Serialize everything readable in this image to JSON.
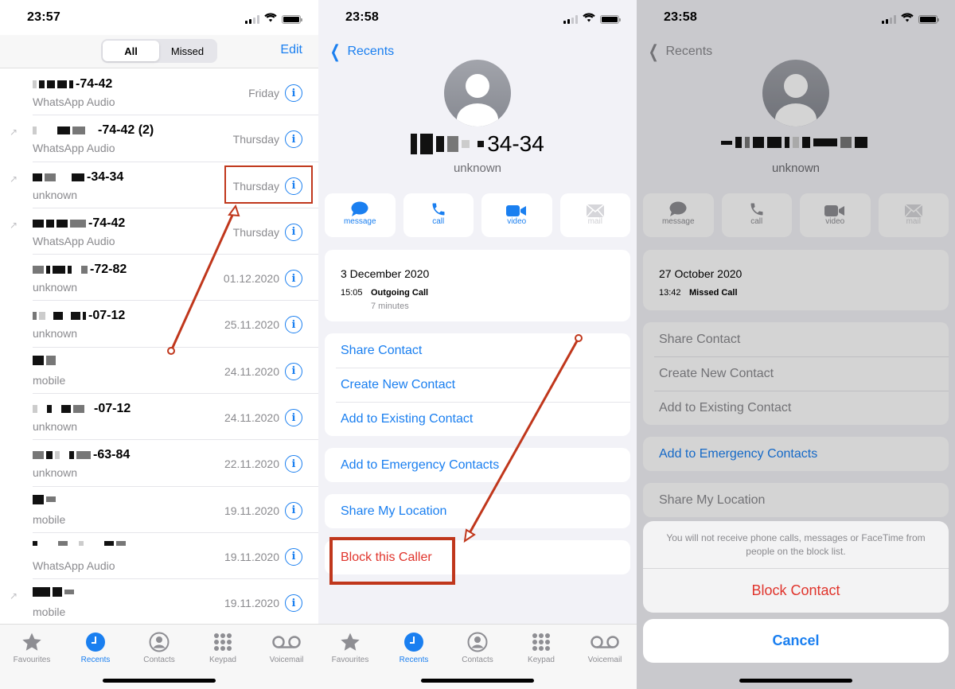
{
  "colors": {
    "accent": "#1a7ff0",
    "destructive": "#e0342c",
    "annotation": "#c0371c",
    "secondary_text": "#8a8a8e"
  },
  "recents_list": {
    "status_time": "23:57",
    "segments": [
      "All",
      "Missed"
    ],
    "active_segment": "All",
    "edit_label": "Edit",
    "info_icon": "i",
    "calls": [
      {
        "number_suffix": "-74-42",
        "type": "WhatsApp Audio",
        "date": "Friday",
        "outgoing": false
      },
      {
        "number_suffix": "-74-42 (2)",
        "type": "WhatsApp Audio",
        "date": "Thursday",
        "outgoing": true
      },
      {
        "number_suffix": "-34-34",
        "type": "unknown",
        "date": "Thursday",
        "outgoing": true,
        "highlighted": true
      },
      {
        "number_suffix": "-74-42",
        "type": "WhatsApp Audio",
        "date": "Thursday",
        "outgoing": true
      },
      {
        "number_suffix": "-72-82",
        "type": "unknown",
        "date": "01.12.2020",
        "outgoing": false
      },
      {
        "number_suffix": "-07-12",
        "type": "unknown",
        "date": "25.11.2020",
        "outgoing": false
      },
      {
        "number_suffix": "",
        "type": "mobile",
        "date": "24.11.2020",
        "outgoing": false
      },
      {
        "number_suffix": "-07-12",
        "type": "unknown",
        "date": "24.11.2020",
        "outgoing": false
      },
      {
        "number_suffix": "-63-84",
        "type": "unknown",
        "date": "22.11.2020",
        "outgoing": false
      },
      {
        "number_suffix": "",
        "type": "mobile",
        "date": "19.11.2020",
        "outgoing": false
      },
      {
        "number_suffix": "",
        "type": "WhatsApp Audio",
        "date": "19.11.2020",
        "outgoing": false
      },
      {
        "number_suffix": "",
        "type": "mobile",
        "date": "19.11.2020",
        "outgoing": true
      }
    ]
  },
  "tabbar": {
    "tabs": [
      {
        "label": "Favourites",
        "icon": "star-icon"
      },
      {
        "label": "Recents",
        "icon": "clock-icon"
      },
      {
        "label": "Contacts",
        "icon": "person-circle-icon"
      },
      {
        "label": "Keypad",
        "icon": "keypad-icon"
      },
      {
        "label": "Voicemail",
        "icon": "voicemail-icon"
      }
    ],
    "active": "Recents"
  },
  "detail": {
    "status_time": "23:58",
    "back_label": "Recents",
    "number_suffix": "34-34",
    "label": "unknown",
    "actions": [
      {
        "label": "message",
        "icon": "message-icon",
        "enabled": true
      },
      {
        "label": "call",
        "icon": "phone-icon",
        "enabled": true
      },
      {
        "label": "video",
        "icon": "video-icon",
        "enabled": true
      },
      {
        "label": "mail",
        "icon": "mail-icon",
        "enabled": false
      }
    ],
    "call_date": "3 December 2020",
    "call_time": "15:05",
    "call_type": "Outgoing Call",
    "call_duration": "7 minutes",
    "options": [
      "Share Contact",
      "Create New Contact",
      "Add to Existing Contact"
    ],
    "emergency": "Add to Emergency Contacts",
    "share_location": "Share My Location",
    "block": "Block this Caller"
  },
  "block_sheet": {
    "status_time": "23:58",
    "back_label": "Recents",
    "label": "unknown",
    "call_date": "27 October 2020",
    "call_time": "13:42",
    "call_type": "Missed Call",
    "message": "You will not receive phone calls, messages or FaceTime from people on the block list.",
    "block_label": "Block Contact",
    "cancel_label": "Cancel"
  }
}
